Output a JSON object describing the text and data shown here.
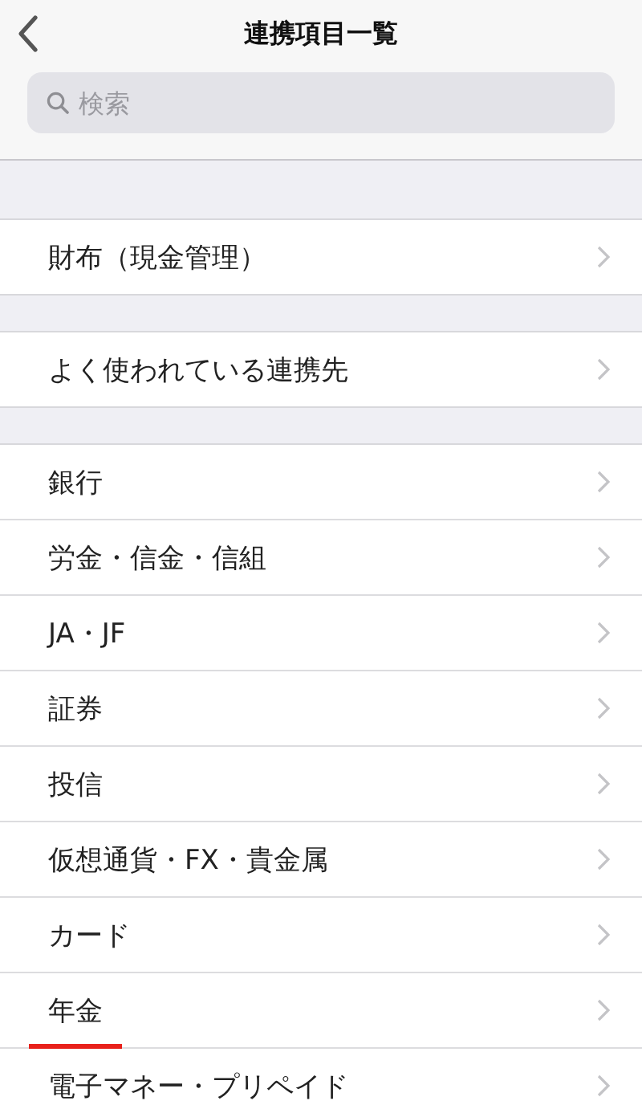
{
  "header": {
    "title": "連携項目一覧",
    "search": {
      "placeholder": "検索"
    }
  },
  "sections": [
    [
      {
        "label": "財布（現金管理）",
        "underlined": false
      }
    ],
    [
      {
        "label": "よく使われている連携先",
        "underlined": false
      }
    ],
    [
      {
        "label": "銀行",
        "underlined": false
      },
      {
        "label": "労金・信金・信組",
        "underlined": false
      },
      {
        "label": "JA・JF",
        "underlined": false
      },
      {
        "label": "証券",
        "underlined": false
      },
      {
        "label": "投信",
        "underlined": false
      },
      {
        "label": "仮想通貨・FX・貴金属",
        "underlined": false
      },
      {
        "label": "カード",
        "underlined": false
      },
      {
        "label": "年金",
        "underlined": true
      },
      {
        "label": "電子マネー・プリペイド",
        "underlined": false
      }
    ]
  ]
}
